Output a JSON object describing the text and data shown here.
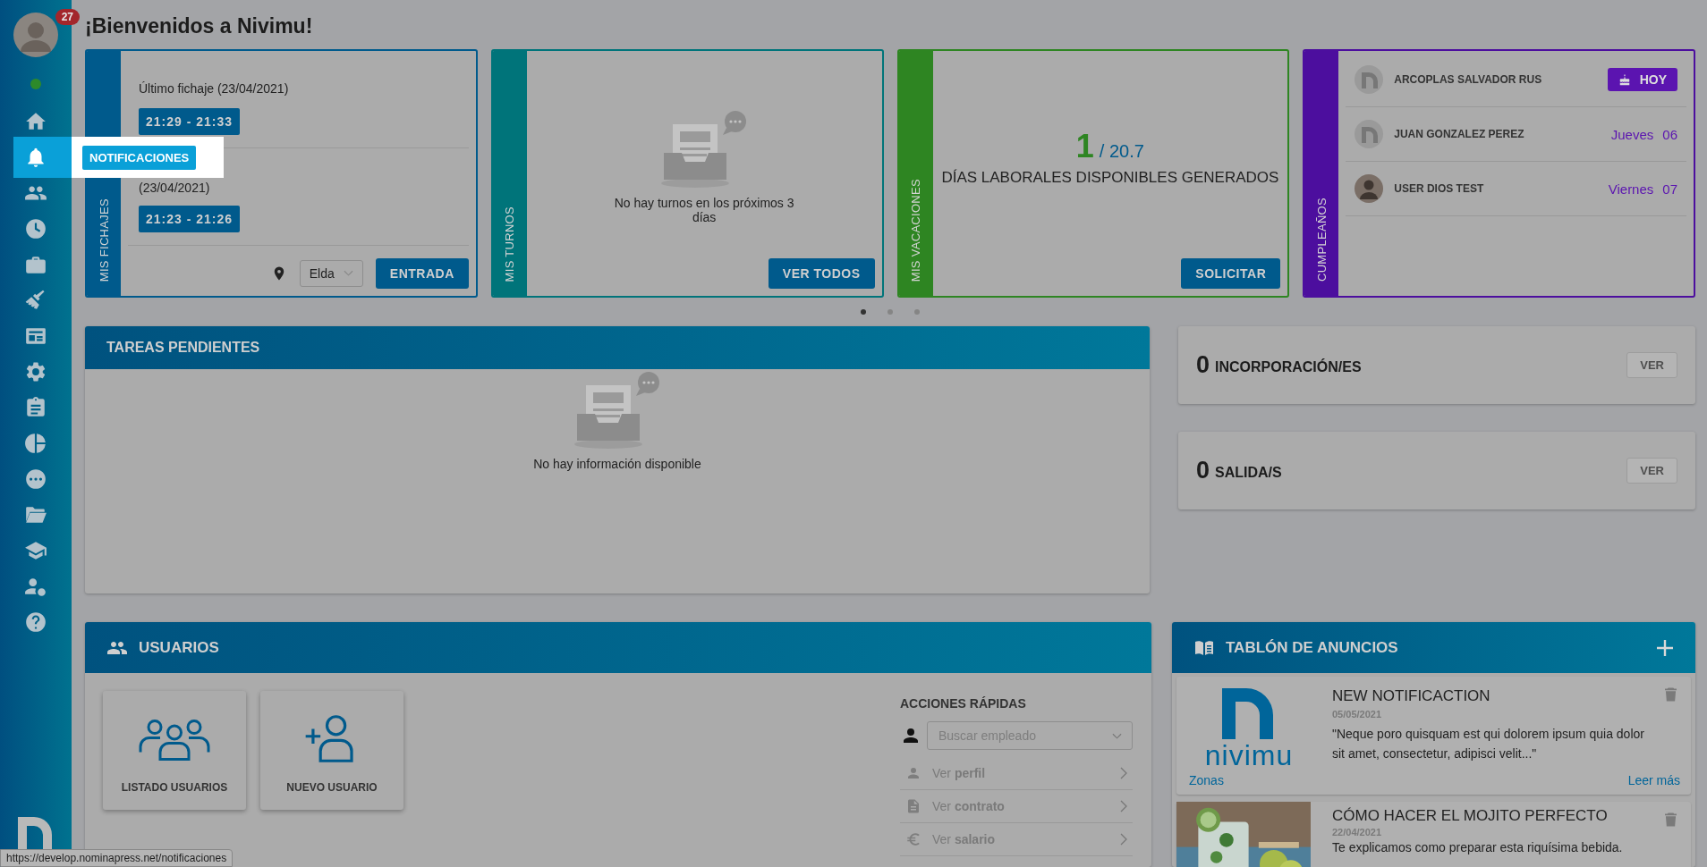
{
  "sidebar": {
    "notification_count": "27",
    "online": true,
    "items": [
      {
        "selected": false
      },
      {
        "selected": true,
        "tooltip": "NOTIFICACIONES"
      },
      {
        "selected": false
      },
      {
        "selected": false
      },
      {
        "selected": false
      },
      {
        "selected": false
      },
      {
        "selected": false
      },
      {
        "selected": false
      },
      {
        "selected": false
      },
      {
        "selected": false
      },
      {
        "selected": false
      },
      {
        "selected": false
      },
      {
        "selected": false
      },
      {
        "selected": false
      },
      {
        "selected": false
      }
    ]
  },
  "title": "¡Bienvenidos a Nivimu!",
  "cards": [
    {
      "kind": "fichajes",
      "label": "MIS FICHAJES",
      "color": "#005a8c",
      "entries": [
        {
          "label": "Último fichaje (23/04/2021)",
          "time": "21:29 - 21:33"
        },
        {
          "label": "(23/04/2021)",
          "time": "21:23 - 21:26"
        }
      ],
      "location": "Elda",
      "button": "ENTRADA"
    },
    {
      "kind": "turnos",
      "label": "MIS TURNOS",
      "color": "#00747a",
      "empty_text": "No hay turnos en los próximos 3 días",
      "button": "VER TODOS"
    },
    {
      "kind": "vacaciones",
      "label": "MIS VACACIONES",
      "color": "#2e8522",
      "available": "1",
      "total": "/ 20.7",
      "caption": "DÍAS LABORALES DISPONIBLES GENERADOS",
      "button": "SOLICITAR"
    },
    {
      "kind": "cumpleanos",
      "label": "CUMPLEAÑOS",
      "color": "#4c0e9e",
      "people": [
        {
          "name": "ARCOPLAS SALVADOR RUS",
          "photo": false,
          "kind": "today",
          "badge": "HOY"
        },
        {
          "name": "JUAN GONZALEZ PEREZ",
          "photo": false,
          "kind": "date",
          "day": "Jueves",
          "date": "06"
        },
        {
          "name": "USER DIOS TEST",
          "photo": true,
          "kind": "date",
          "day": "Viernes",
          "date": "07"
        }
      ]
    }
  ],
  "carousel_dots": [
    {
      "selected": true
    },
    {
      "selected": false
    },
    {
      "selected": false
    }
  ],
  "tasks": {
    "title": "TAREAS PENDIENTES",
    "empty_text": "No hay información disponible"
  },
  "counters": [
    {
      "count": "0",
      "label": "INCORPORACIÓN/ES",
      "button": "VER",
      "disabled": true
    },
    {
      "count": "0",
      "label": "SALIDA/S",
      "button": "VER",
      "disabled": true
    }
  ],
  "users": {
    "title": "USUARIOS",
    "tiles": [
      {
        "label": "LISTADO USUARIOS"
      },
      {
        "label": "NUEVO USUARIO"
      }
    ],
    "quick_actions": {
      "title": "ACCIONES RÁPIDAS",
      "search": {
        "placeholder": "Buscar empleado"
      },
      "items": [
        "Ver **perfil**",
        "Ver **contrato**",
        "Ver **salario**"
      ]
    }
  },
  "board": {
    "title": "TABLÓN DE ANUNCIOS",
    "posts": [
      {
        "kind": "logo",
        "logo_text": "nivimu",
        "title": "NEW NOTIFICACTION",
        "date": "05/05/2021",
        "excerpt": "\"Neque poro quisquam est qui dolorem ipsum quia dolor sit amet, consectetur, adipisci velit...\"",
        "tag": "Zonas",
        "link": "Leer más"
      },
      {
        "kind": "picture",
        "title": "CÓMO HACER EL MOJITO PERFECTO",
        "date": "22/04/2021",
        "excerpt": "Te explicamos como preparar esta riquísima bebida."
      }
    ]
  },
  "status_url": "https://develop.nominapress.net/notificaciones"
}
